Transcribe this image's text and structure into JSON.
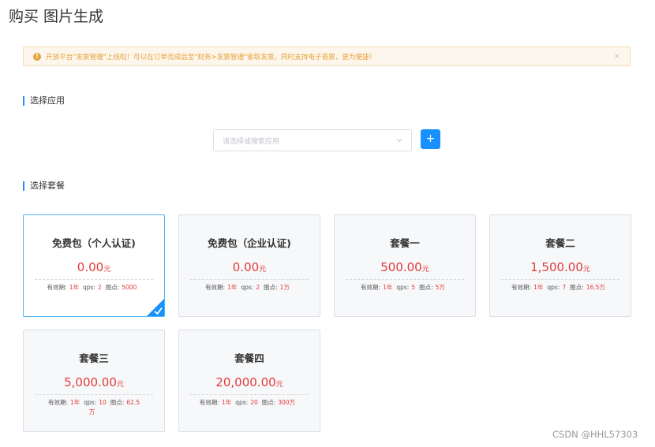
{
  "page": {
    "title": "购买 图片生成"
  },
  "notice": {
    "text": "开放平台\"发票管理\"上线啦！可以在订单完成后至\"财务>发票管理\"索取发票，同时支持电子普票，更为便捷！",
    "close": "×",
    "icon": "warning-circle-icon",
    "icon_glyph": "!"
  },
  "sections": {
    "app": "选择应用",
    "package": "选择套餐"
  },
  "app_select": {
    "placeholder": "请选择或搜索应用",
    "add_label": "+"
  },
  "meta_labels": {
    "validity": "有效期:",
    "qps": "qps:",
    "points": "图点:"
  },
  "packages": [
    {
      "name": "免费包（个人认证)",
      "price": "0.00",
      "unit": "元",
      "validity": "1年",
      "qps": "2",
      "points": "5000",
      "selected": true
    },
    {
      "name": "免费包（企业认证)",
      "price": "0.00",
      "unit": "元",
      "validity": "1年",
      "qps": "2",
      "points": "1万",
      "selected": false
    },
    {
      "name": "套餐一",
      "price": "500.00",
      "unit": "元",
      "validity": "1年",
      "qps": "5",
      "points": "5万",
      "selected": false
    },
    {
      "name": "套餐二",
      "price": "1,500.00",
      "unit": "元",
      "validity": "1年",
      "qps": "7",
      "points": "16.5万",
      "selected": false
    },
    {
      "name": "套餐三",
      "price": "5,000.00",
      "unit": "元",
      "validity": "1年",
      "qps": "10",
      "points": "62.5万",
      "selected": false
    },
    {
      "name": "套餐四",
      "price": "20,000.00",
      "unit": "元",
      "validity": "1年",
      "qps": "20",
      "points": "300万",
      "selected": false
    }
  ],
  "watermark": "CSDN @HHL57303",
  "colors": {
    "accent": "#1890ff",
    "price": "#e23a3a",
    "warning": "#e6a23c",
    "selected_border": "#4db3f5"
  }
}
